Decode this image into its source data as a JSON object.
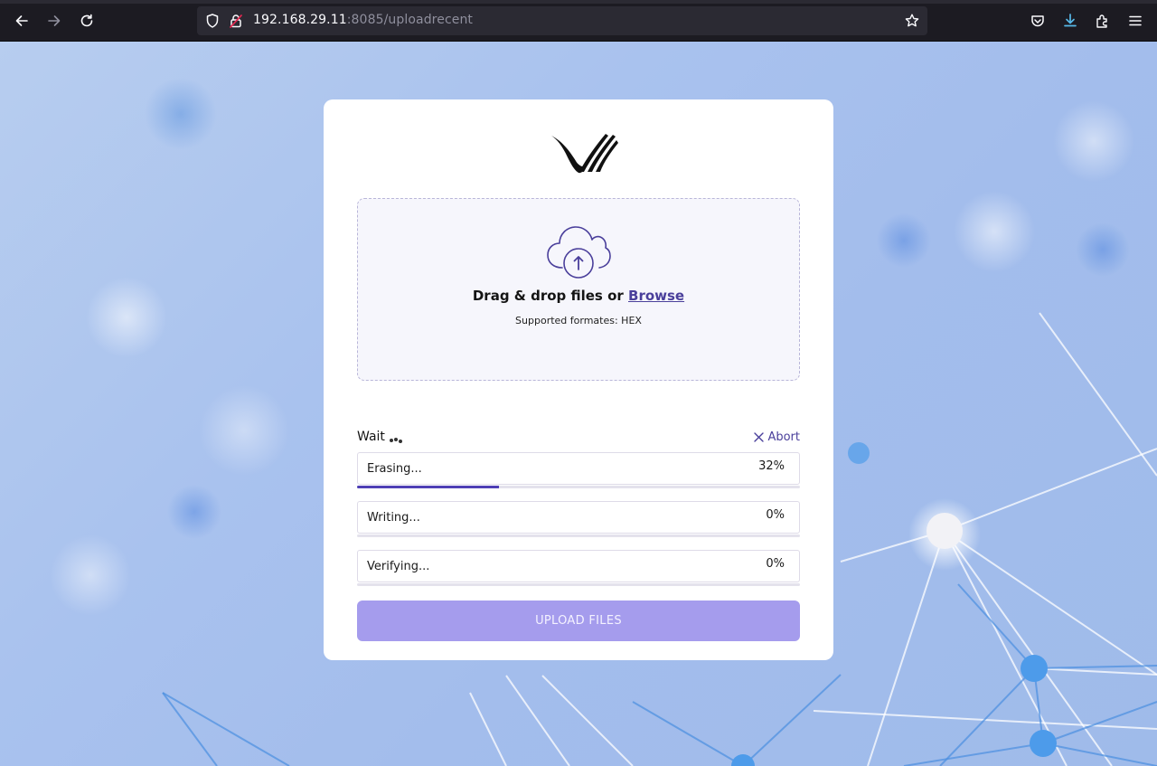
{
  "browser": {
    "url_host": "192.168.29.11",
    "url_rest": ":8085/uploadrecent",
    "icons": [
      "back-arrow-icon",
      "forward-arrow-icon",
      "reload-icon",
      "shield-icon",
      "insecure-lock-icon",
      "bookmark-star-icon",
      "pocket-icon",
      "download-icon",
      "extensions-icon",
      "menu-icon"
    ],
    "download_icon_color": "#57b8e8"
  },
  "dropzone": {
    "title_prefix": "Drag & drop files or ",
    "browse_link": "Browse",
    "subtitle": "Supported formates: HEX"
  },
  "status": {
    "wait_label": "Wait",
    "abort_label": "Abort"
  },
  "steps": [
    {
      "label": "Erasing...",
      "percent": "32%",
      "progress": 0.32
    },
    {
      "label": "Writing...",
      "percent": "0%",
      "progress": 0
    },
    {
      "label": "Verifying...",
      "percent": "0%",
      "progress": 0
    }
  ],
  "upload_button": {
    "label": "UPLOAD FILES"
  },
  "colors": {
    "accent": "#4e3fb5",
    "link": "#4a3f9b",
    "button_bg": "#a59ced"
  }
}
